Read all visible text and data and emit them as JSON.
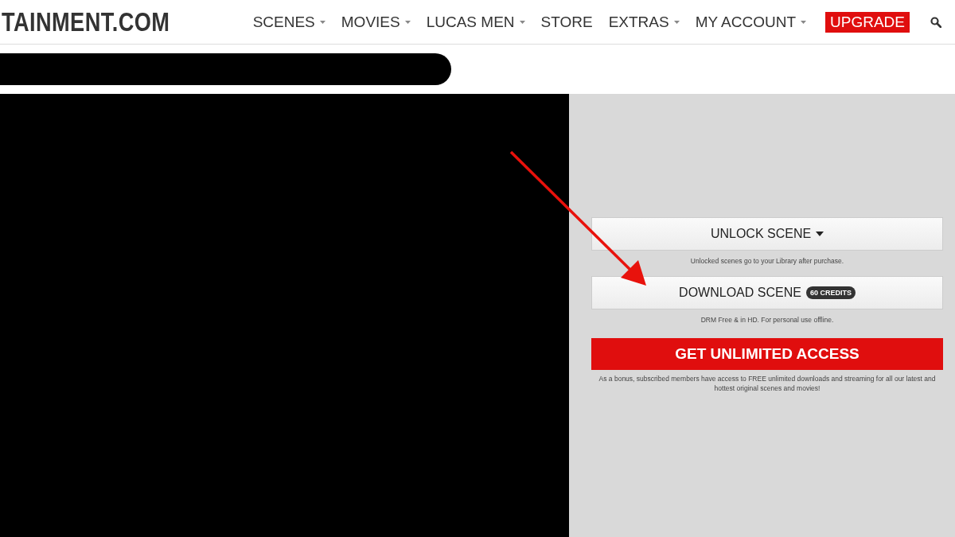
{
  "header": {
    "logo": "TAINMENT.COM",
    "nav": [
      {
        "label": "SCENES",
        "kind": "menu"
      },
      {
        "label": "MOVIES",
        "kind": "menu"
      },
      {
        "label": "LUCAS MEN",
        "kind": "menu"
      },
      {
        "label": "STORE",
        "kind": "link"
      },
      {
        "label": "EXTRAS",
        "kind": "menu"
      },
      {
        "label": "MY ACCOUNT",
        "kind": "menu"
      },
      {
        "label": "UPGRADE",
        "kind": "highlight"
      }
    ]
  },
  "panel": {
    "unlock": {
      "label": "UNLOCK SCENE",
      "note": "Unlocked scenes go to your Library after purchase."
    },
    "download": {
      "label": "DOWNLOAD SCENE",
      "badge": "60 CREDITS",
      "note": "DRM Free & in HD. For personal use offline."
    },
    "cta": {
      "label": "GET UNLIMITED ACCESS",
      "note": "As a bonus, subscribed members have access to FREE unlimited downloads and streaming for all our latest and hottest original scenes and movies!"
    }
  }
}
